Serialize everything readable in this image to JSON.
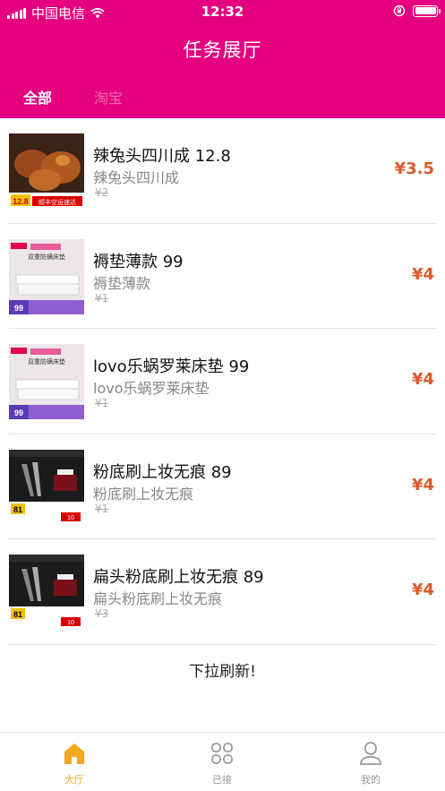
{
  "status_bar": {
    "carrier": "中国电信",
    "time": "12:32"
  },
  "header": {
    "title": "任务展厅",
    "tabs": [
      {
        "label": "全部",
        "active": true
      },
      {
        "label": "淘宝",
        "active": false
      }
    ],
    "color": "#E4007F"
  },
  "tasks": [
    {
      "title": "辣兔头四川成 12.8",
      "subtitle": "辣兔头四川成",
      "old_price": "¥2",
      "reward": "¥3.5",
      "thumb_banner": "12.8",
      "thumb_tag": "顺丰空运速达"
    },
    {
      "title": "褥垫薄款 99",
      "subtitle": "褥垫薄款",
      "old_price": "¥1",
      "reward": "¥4",
      "thumb_banner": "99",
      "thumb_tag": "双重防螨床垫"
    },
    {
      "title": "lovo乐蜗罗莱床垫 99",
      "subtitle": "lovo乐蜗罗莱床垫",
      "old_price": "¥1",
      "reward": "¥4",
      "thumb_banner": "99",
      "thumb_tag": "双重防螨床垫"
    },
    {
      "title": "粉底刷上妆无痕 89",
      "subtitle": "粉底刷上妆无痕",
      "old_price": "¥1",
      "reward": "¥4",
      "thumb_banner": "81",
      "thumb_tag": "10"
    },
    {
      "title": "扁头粉底刷上妆无痕 89",
      "subtitle": "扁头粉底刷上妆无痕",
      "old_price": "¥3",
      "reward": "¥4",
      "thumb_banner": "81",
      "thumb_tag": "10"
    }
  ],
  "refresh_text": "下拉刷新!",
  "tabbar": {
    "items": [
      {
        "label": "大厅",
        "icon": "home-icon",
        "active": true
      },
      {
        "label": "已接",
        "icon": "grid-icon",
        "active": false
      },
      {
        "label": "我的",
        "icon": "user-icon",
        "active": false
      }
    ],
    "active_color": "#F5A623"
  },
  "colors": {
    "reward": "#DC5A2A"
  }
}
